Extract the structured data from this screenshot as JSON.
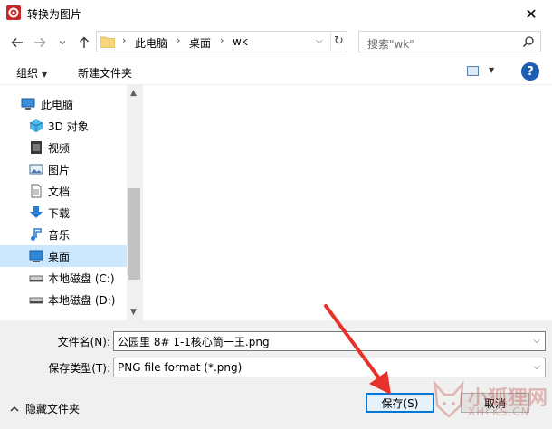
{
  "window": {
    "title": "转换为图片",
    "close_glyph": "✕"
  },
  "address_bar": {
    "crumbs": [
      "此电脑",
      "桌面",
      "wk"
    ],
    "separator": "›",
    "search_placeholder": "搜索\"wk\""
  },
  "toolbar": {
    "organize": "组织",
    "new_folder": "新建文件夹",
    "help": "?"
  },
  "nav_tree": {
    "items": [
      {
        "label": "此电脑",
        "icon": "computer-icon"
      },
      {
        "label": "3D 对象",
        "icon": "cube-3d-icon"
      },
      {
        "label": "视频",
        "icon": "video-icon"
      },
      {
        "label": "图片",
        "icon": "picture-icon"
      },
      {
        "label": "文档",
        "icon": "document-icon"
      },
      {
        "label": "下载",
        "icon": "download-icon"
      },
      {
        "label": "音乐",
        "icon": "music-icon"
      },
      {
        "label": "桌面",
        "icon": "desktop-icon",
        "selected": true
      },
      {
        "label": "本地磁盘 (C:)",
        "icon": "drive-c-icon"
      },
      {
        "label": "本地磁盘 (D:)",
        "icon": "drive-d-icon"
      }
    ]
  },
  "form": {
    "filename_label": "文件名(N):",
    "filename_value": "公园里 8# 1-1核心筒一王.png",
    "filetype_label": "保存类型(T):",
    "filetype_value": "PNG file format (*.png)"
  },
  "footer": {
    "hide_folders": "隐藏文件夹",
    "save": "保存(S)",
    "cancel": "取消"
  },
  "watermark": {
    "line1": "小狐狸网",
    "line2": "XHLKS.CN"
  },
  "colors": {
    "accent": "#0078d7",
    "selection": "#cce8ff",
    "arrow": "#e8312a"
  }
}
